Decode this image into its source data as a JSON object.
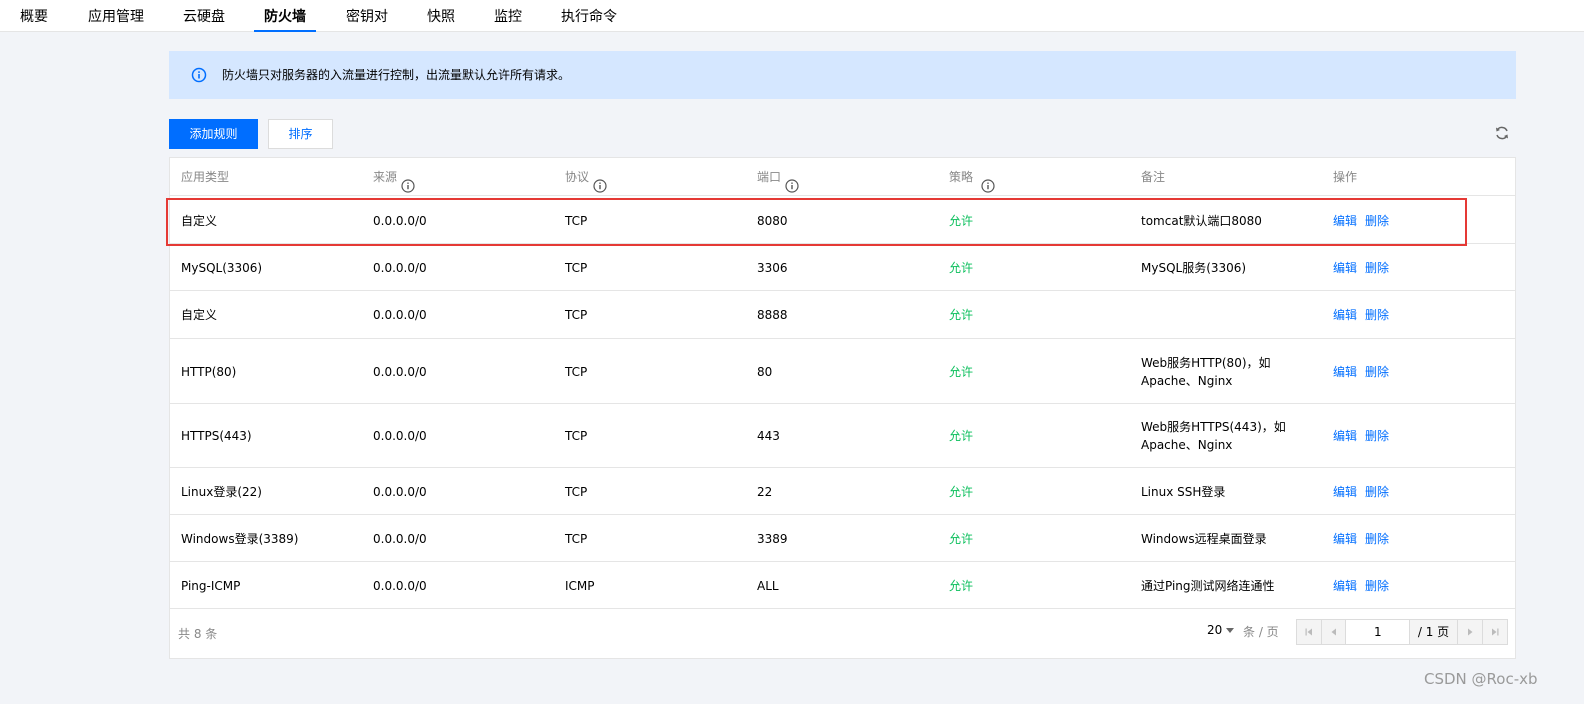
{
  "tabs": [
    {
      "label": "概要",
      "active": false
    },
    {
      "label": "应用管理",
      "active": false
    },
    {
      "label": "云硬盘",
      "active": false
    },
    {
      "label": "防火墙",
      "active": true
    },
    {
      "label": "密钥对",
      "active": false
    },
    {
      "label": "快照",
      "active": false
    },
    {
      "label": "监控",
      "active": false
    },
    {
      "label": "执行命令",
      "active": false
    }
  ],
  "notice": {
    "text": "防火墙只对服务器的入流量进行控制，出流量默认允许所有请求。",
    "icon": "info-circle-icon"
  },
  "toolbar": {
    "add_label": "添加规则",
    "sort_label": "排序",
    "refresh_icon": "refresh-icon"
  },
  "table": {
    "headers": [
      "应用类型",
      "来源",
      "协议",
      "端口",
      "策略",
      "备注",
      "操作"
    ],
    "rows": [
      {
        "type": "自定义",
        "source": "0.0.0.0/0",
        "protocol": "TCP",
        "port": "8080",
        "policy": "允许",
        "note": "tomcat默认端口8080",
        "edit": "编辑",
        "delete": "删除"
      },
      {
        "type": "MySQL(3306)",
        "source": "0.0.0.0/0",
        "protocol": "TCP",
        "port": "3306",
        "policy": "允许",
        "note": "MySQL服务(3306)",
        "edit": "编辑",
        "delete": "删除"
      },
      {
        "type": "自定义",
        "source": "0.0.0.0/0",
        "protocol": "TCP",
        "port": "8888",
        "policy": "允许",
        "note": "",
        "edit": "编辑",
        "delete": "删除"
      },
      {
        "type": "HTTP(80)",
        "source": "0.0.0.0/0",
        "protocol": "TCP",
        "port": "80",
        "policy": "允许",
        "note": "Web服务HTTP(80)，如Apache、Nginx",
        "edit": "编辑",
        "delete": "删除"
      },
      {
        "type": "HTTPS(443)",
        "source": "0.0.0.0/0",
        "protocol": "TCP",
        "port": "443",
        "policy": "允许",
        "note": "Web服务HTTPS(443)，如Apache、Nginx",
        "edit": "编辑",
        "delete": "删除"
      },
      {
        "type": "Linux登录(22)",
        "source": "0.0.0.0/0",
        "protocol": "TCP",
        "port": "22",
        "policy": "允许",
        "note": "Linux SSH登录",
        "edit": "编辑",
        "delete": "删除"
      },
      {
        "type": "Windows登录(3389)",
        "source": "0.0.0.0/0",
        "protocol": "TCP",
        "port": "3389",
        "policy": "允许",
        "note": "Windows远程桌面登录",
        "edit": "编辑",
        "delete": "删除"
      },
      {
        "type": "Ping-ICMP",
        "source": "0.0.0.0/0",
        "protocol": "ICMP",
        "port": "ALL",
        "policy": "允许",
        "note": "通过Ping测试网络连通性",
        "edit": "编辑",
        "delete": "删除"
      }
    ]
  },
  "footer": {
    "total": "共 8 条",
    "page_size": "20",
    "per_page": "条 / 页",
    "current_page": "1",
    "total_pages": "/ 1 页"
  },
  "watermark": "CSDN @Roc-xb",
  "colors": {
    "primary": "#006eff",
    "allow": "#0abf5b",
    "notice_bg": "#d5e7ff",
    "highlight": "#e53935"
  }
}
